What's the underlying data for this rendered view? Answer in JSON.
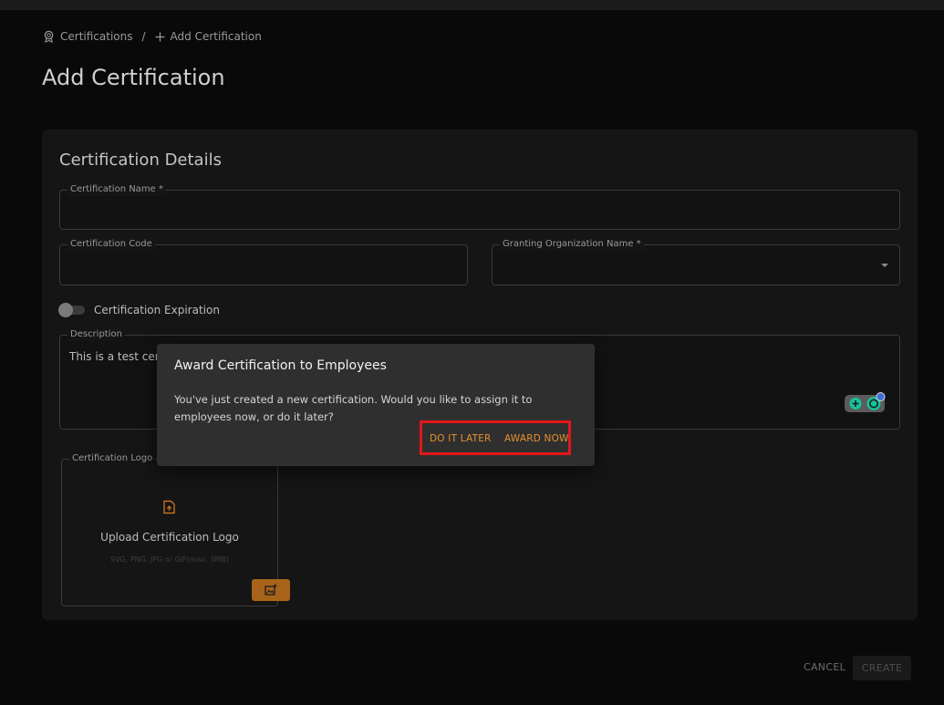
{
  "breadcrumb": {
    "root_label": "Certifications",
    "separator": "/",
    "current_label": "Add Certification"
  },
  "page": {
    "title": "Add Certification"
  },
  "form": {
    "section_title": "Certification Details",
    "certification_name": {
      "label": "Certification Name *",
      "value": ""
    },
    "certification_code": {
      "label": "Certification Code",
      "value": ""
    },
    "granting_org": {
      "label": "Granting Organization Name *",
      "value": ""
    },
    "expiration_toggle": {
      "label": "Certification Expiration",
      "enabled": false
    },
    "description": {
      "label": "Description",
      "value": "This is a test certi"
    },
    "logo": {
      "label": "Certification Logo",
      "upload_title": "Upload Certification Logo",
      "upload_hint": "SVG, PNG, JPG or GIF(max. 3MB)"
    }
  },
  "footer": {
    "cancel_label": "CANCEL",
    "create_label": "CREATE"
  },
  "dialog": {
    "title": "Award Certification to Employees",
    "message": "You've just created a new certification. Would you like to assign it to employees now, or do it later?",
    "later_label": "DO IT LATER",
    "award_label": "AWARD NOW"
  },
  "colors": {
    "accent": "#e49131",
    "highlight": "#e4161a",
    "upload_button": "#a8631b"
  },
  "icons": {
    "breadcrumb_root": "award-icon",
    "breadcrumb_current": "plus-icon",
    "upload": "file-upload-icon",
    "image_add": "image-add-icon",
    "grammarly": "grammarly-icon"
  }
}
